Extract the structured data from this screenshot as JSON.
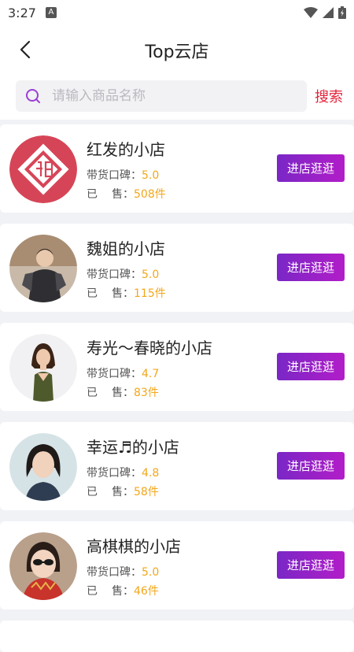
{
  "status": {
    "time": "3:27",
    "a_icon": "A"
  },
  "header": {
    "title": "Top云店"
  },
  "search": {
    "placeholder": "请输入商品名称",
    "value": "",
    "button": "搜索"
  },
  "labels": {
    "rating": "带货口碑：",
    "sold_a": "已",
    "sold_b": "售："
  },
  "shop_button_label": "进店逛逛",
  "shops": [
    {
      "name": "红发的小店",
      "rating": "5.0",
      "sold": "508件"
    },
    {
      "name": "魏姐的小店",
      "rating": "5.0",
      "sold": "115件"
    },
    {
      "name": "寿光～春晓的小店",
      "rating": "4.7",
      "sold": "83件"
    },
    {
      "name": "幸运♬的小店",
      "rating": "4.8",
      "sold": "58件"
    },
    {
      "name": "高棋棋的小店",
      "rating": "5.0",
      "sold": "46件"
    }
  ],
  "colors": {
    "accent_start": "#7a27c6",
    "accent_end": "#b21dc8",
    "value": "#f3a71b",
    "search_button": "#e5233a"
  }
}
